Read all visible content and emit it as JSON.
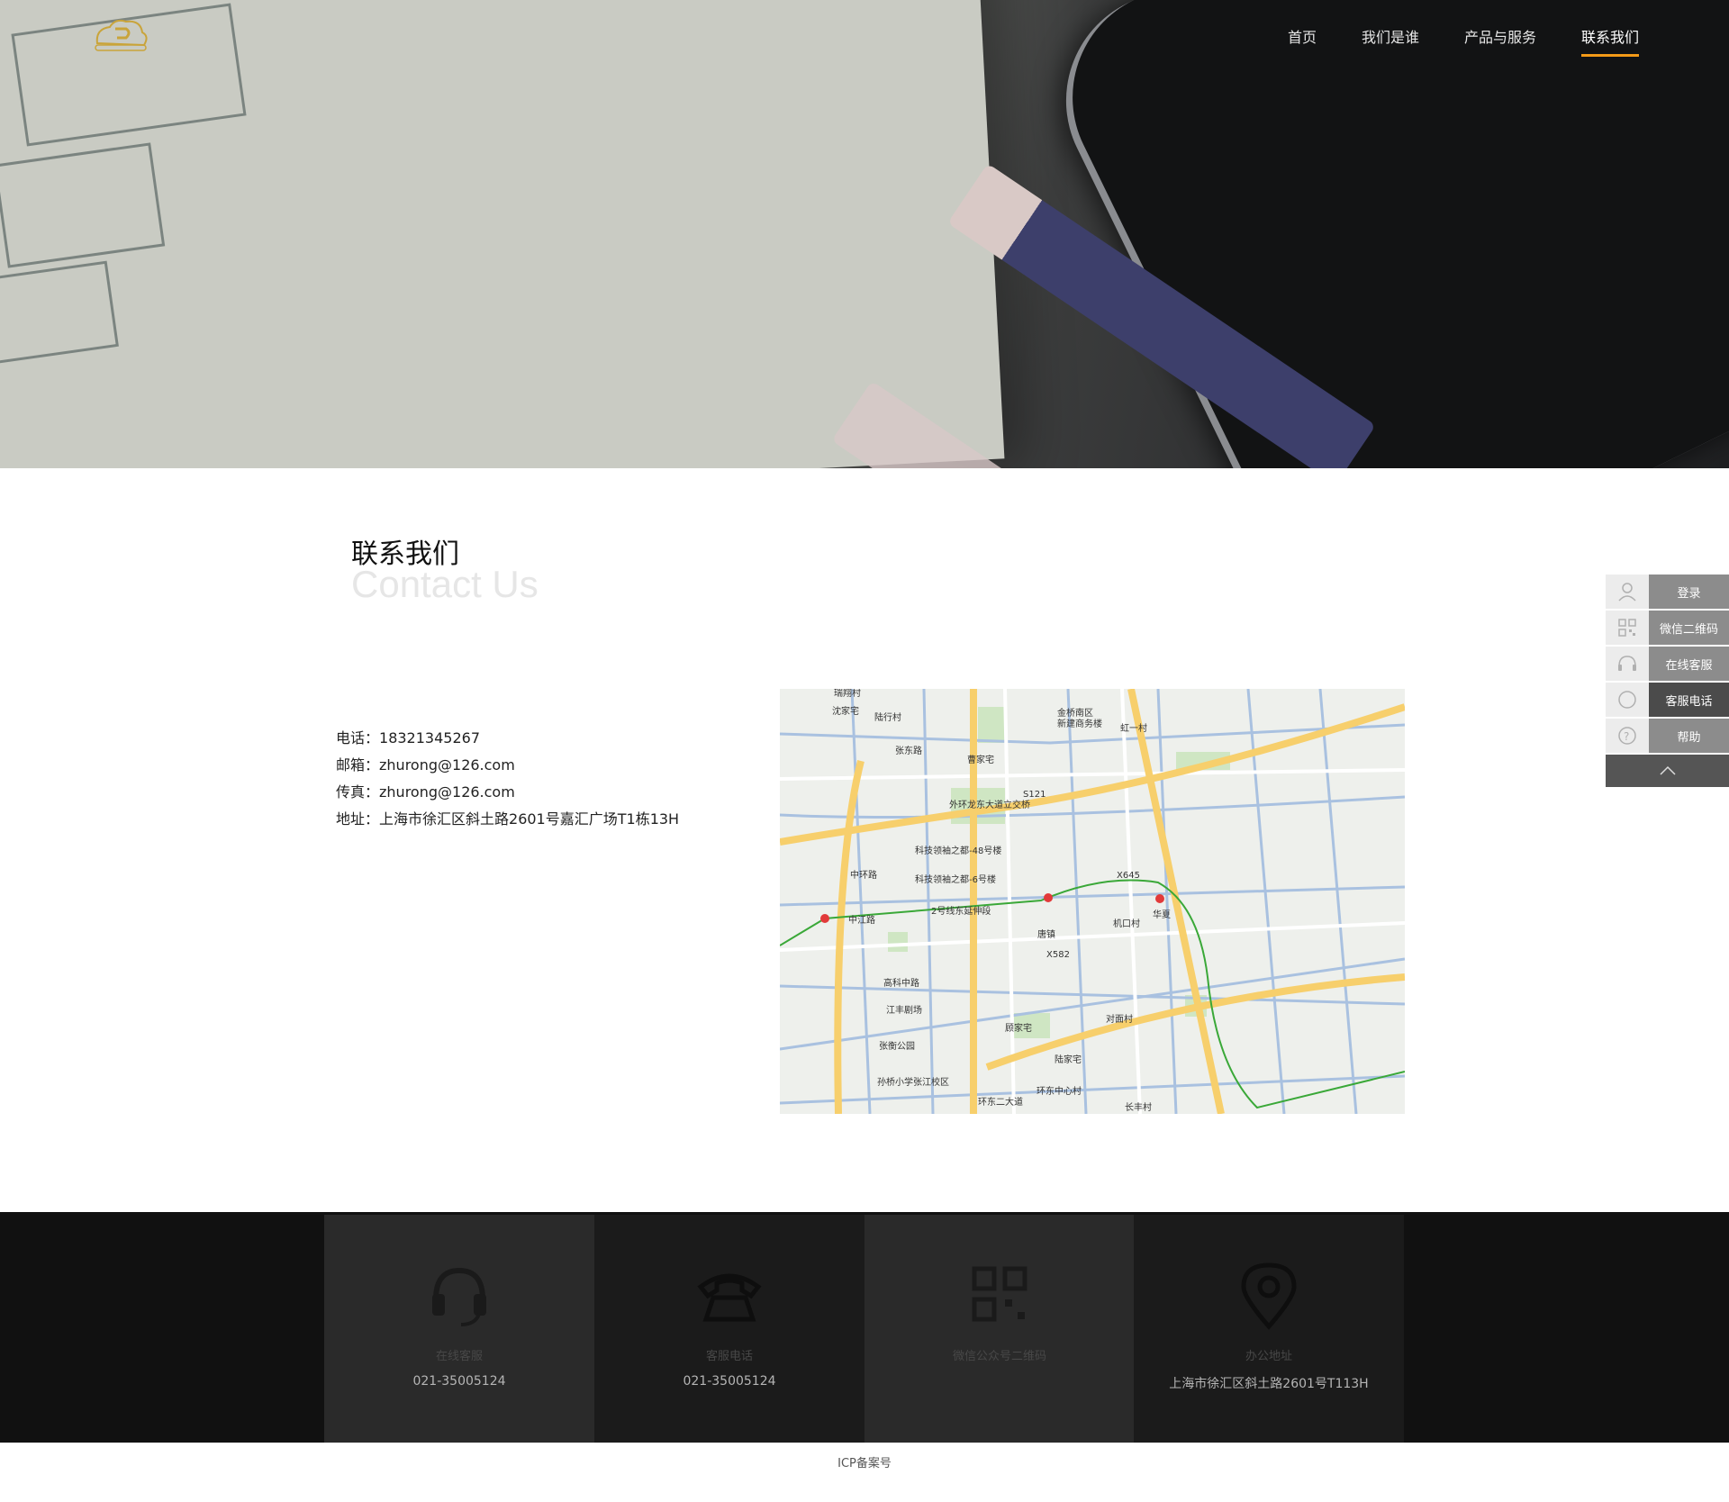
{
  "nav": {
    "items": [
      {
        "label": "首页",
        "active": false
      },
      {
        "label": "我们是谁",
        "active": false
      },
      {
        "label": "产品与服务",
        "active": false
      },
      {
        "label": "联系我们",
        "active": true
      }
    ],
    "accent_color": "#f39a18"
  },
  "contact": {
    "title_cn": "联系我们",
    "title_en": "Contact Us",
    "phone_label": "电话：",
    "phone": "18321345267",
    "email_label": "邮箱：",
    "email": "zhurong@126.com",
    "fax_label": "传真：",
    "fax": "zhurong@126.com",
    "address_label": "地址：",
    "address": "上海市徐汇区斜土路2601号嘉汇广场T1栋13H"
  },
  "map": {
    "labels": [
      "瑞翔村",
      "沈家宅",
      "陆行村",
      "张东路",
      "曹家宅",
      "金桥南区",
      "新建商务楼",
      "虹一村",
      "外环龙东大道立交桥",
      "S121",
      "科技领袖之都-48号楼",
      "科技领袖之都-6号楼",
      "中环路",
      "2号线东延伸段",
      "X645",
      "华夏",
      "机口村",
      "唐镇",
      "X582",
      "高科中路",
      "江丰剧场",
      "张衡公园",
      "孙桥小学张江校区",
      "顾家宅",
      "陆家宅",
      "对面村",
      "环东中心村",
      "环东二大道",
      "长丰村",
      "中江路"
    ]
  },
  "side": {
    "items": [
      {
        "label": "登录",
        "icon": "user-icon"
      },
      {
        "label": "微信二维码",
        "icon": "qrcode-icon"
      },
      {
        "label": "在线客服",
        "icon": "headset-icon"
      },
      {
        "label": "客服电话",
        "icon": "chat-bubble-icon"
      },
      {
        "label": "帮助",
        "icon": "question-icon"
      }
    ]
  },
  "footer": {
    "cards": [
      {
        "label": "在线客服",
        "value": "021-35005124",
        "icon": "headset-icon"
      },
      {
        "label": "客服电话",
        "value": "021-35005124",
        "icon": "telephone-icon"
      },
      {
        "label": "微信公众号二维码",
        "value": "",
        "icon": "qrcode-icon"
      },
      {
        "label": "办公地址",
        "value": "上海市徐汇区斜土路2601号T113H",
        "icon": "location-pin-icon"
      }
    ],
    "icp": "ICP备案号"
  }
}
